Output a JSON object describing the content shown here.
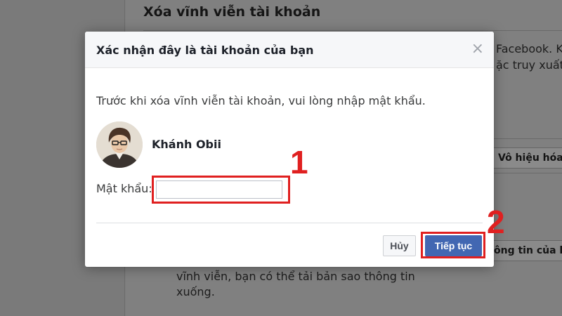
{
  "background": {
    "heading": "Xóa vĩnh viễn tài khoản",
    "right_line_1": "Facebook. K",
    "right_line_2": "ặc truy xuất",
    "deactivate_button": "Vô hiệu hóa",
    "download_button": "ông tin của b",
    "bottom_line_1": "vĩnh viễn, bạn có thể tải bản sao thông tin",
    "bottom_line_2": "xuống."
  },
  "dialog": {
    "title": "Xác nhận đây là tài khoản của bạn",
    "close_symbol": "×",
    "prompt": "Trước khi xóa vĩnh viễn tài khoản, vui lòng nhập mật khẩu.",
    "user_name": "Khánh Obii",
    "password_label": "Mật khẩu:",
    "password_value": "",
    "cancel_label": "Hủy",
    "continue_label": "Tiếp tục"
  },
  "annotations": {
    "step_1": "1",
    "step_2": "2"
  },
  "colors": {
    "primary_button": "#4267b2",
    "annotation_red": "#e02020",
    "overlay": "#7e7e7e"
  }
}
